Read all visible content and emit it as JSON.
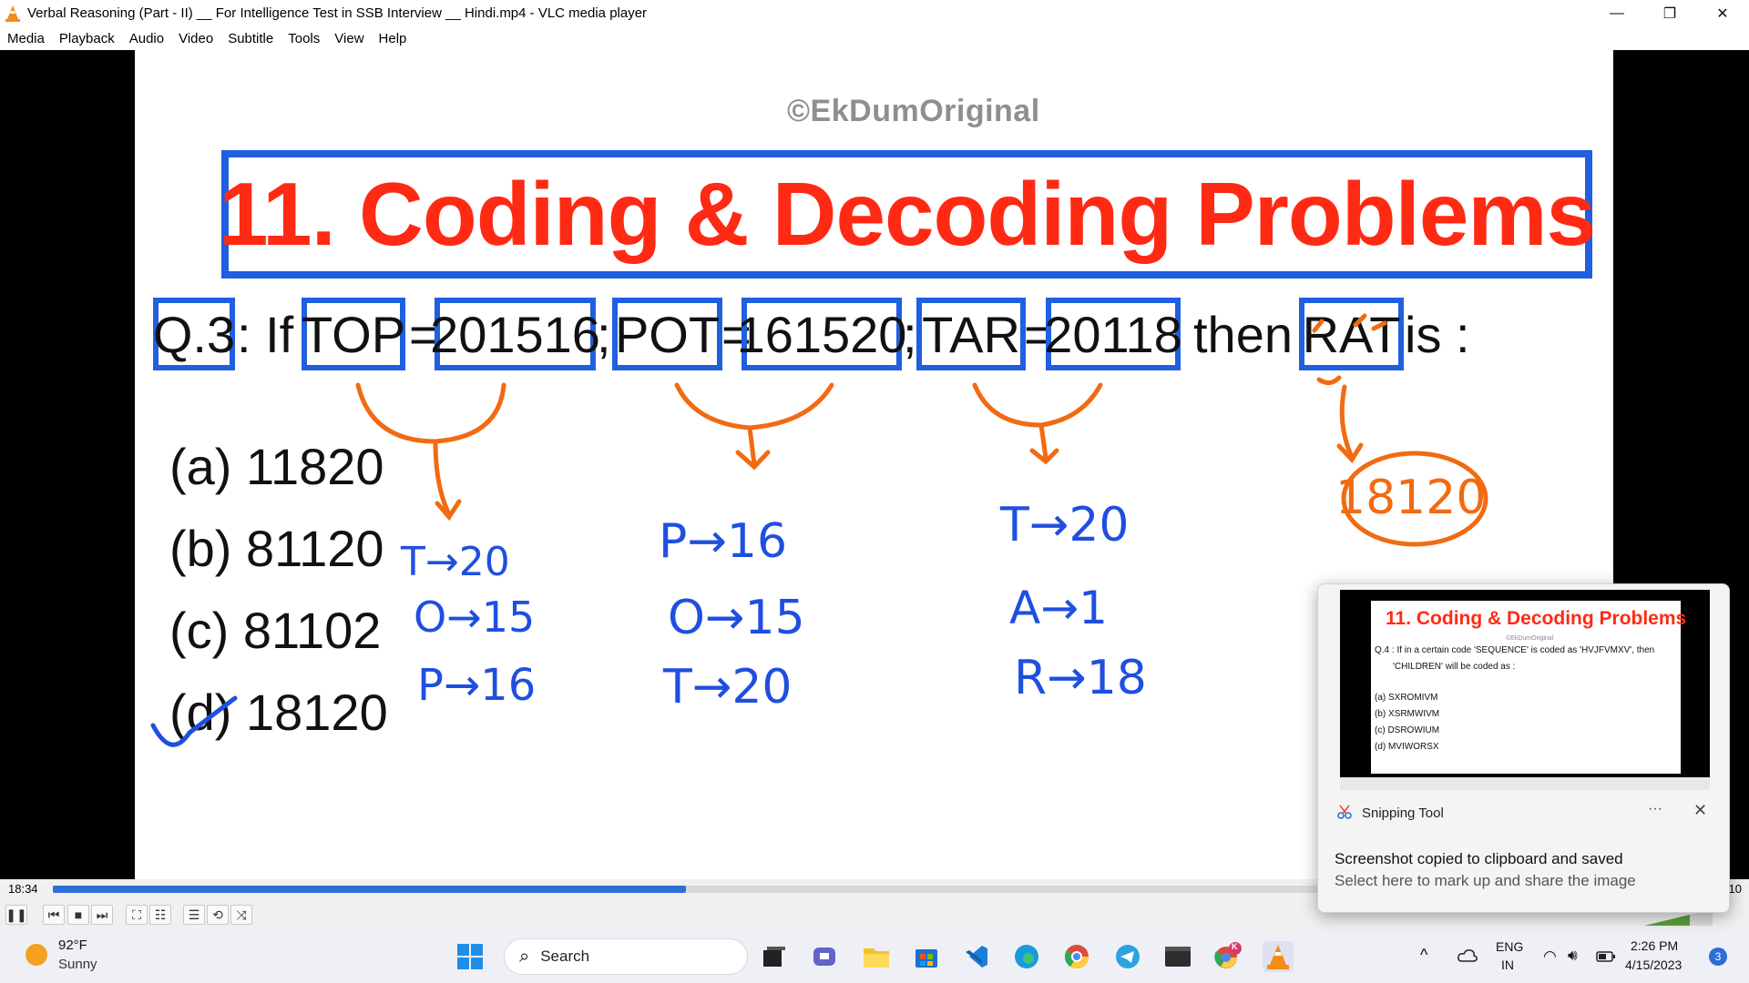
{
  "window": {
    "title": "Verbal Reasoning (Part - II) __ For Intelligence Test in SSB Interview __ Hindi.mp4 - VLC media player",
    "minimize": "—",
    "restore": "❐",
    "close": "✕"
  },
  "menu": [
    "Media",
    "Playback",
    "Audio",
    "Video",
    "Subtitle",
    "Tools",
    "View",
    "Help"
  ],
  "slide": {
    "watermark": "©EkDumOriginal",
    "heading": "11. Coding & Decoding Problems",
    "question": {
      "q": "Q.3",
      "colon_if": ": If",
      "w1": "TOP",
      "eq1": "=",
      "c1": "201516",
      "semi1": ";",
      "w2": "POT",
      "eq2": "=",
      "c2": "161520",
      "semi2": ";",
      "w3": "TAR",
      "eq3": "=",
      "c3": "20118",
      "then": "then",
      "w4": "RAT",
      "is": "is :"
    },
    "options": [
      "(a) 11820",
      "(b) 81120",
      "(c) 81102",
      "(d) 18120"
    ],
    "handwriting": {
      "col1": [
        "T→20",
        "O→15",
        "P→16"
      ],
      "col2": [
        "P→16",
        "O→15",
        "T→20"
      ],
      "col3": [
        "T→20",
        "A→1",
        "R→18"
      ],
      "answer": "18120"
    },
    "colors": {
      "heading": "#ff2a14",
      "box": "#1f5fe0",
      "ink_blue": "#1f4fe0",
      "ink_orange": "#f26a12"
    }
  },
  "player": {
    "elapsed": "18:34",
    "total": "10",
    "progress": 0.38,
    "buttons": [
      "pause",
      "previous",
      "stop",
      "next",
      "fullscreen",
      "extended-settings",
      "playlist",
      "loop",
      "shuffle"
    ]
  },
  "toast": {
    "app": "Snipping Tool",
    "more": "···",
    "close": "✕",
    "heading": "Screenshot copied to clipboard and saved",
    "body": "Select here to mark up and share the image",
    "thumb": {
      "title": "11. Coding & Decoding Problems",
      "watermark": "©EkDumOriginal",
      "q_line1": "Q.4 : If in a certain code 'SEQUENCE' is coded as 'HVJFVMXV', then",
      "q_line2": "'CHILDREN' will be coded as :",
      "options": [
        "(a) SXROMIVM",
        "(b) XSRMWIVM",
        "(c) DSROWIUM",
        "(d) MVIWORSX"
      ]
    }
  },
  "taskbar": {
    "weather_temp": "92°F",
    "weather_desc": "Sunny",
    "search_label": "Search",
    "lang_top": "ENG",
    "lang_bottom": "IN",
    "time": "2:26 PM",
    "date": "4/15/2023",
    "notifications": "3",
    "chrome_badge": "K"
  }
}
